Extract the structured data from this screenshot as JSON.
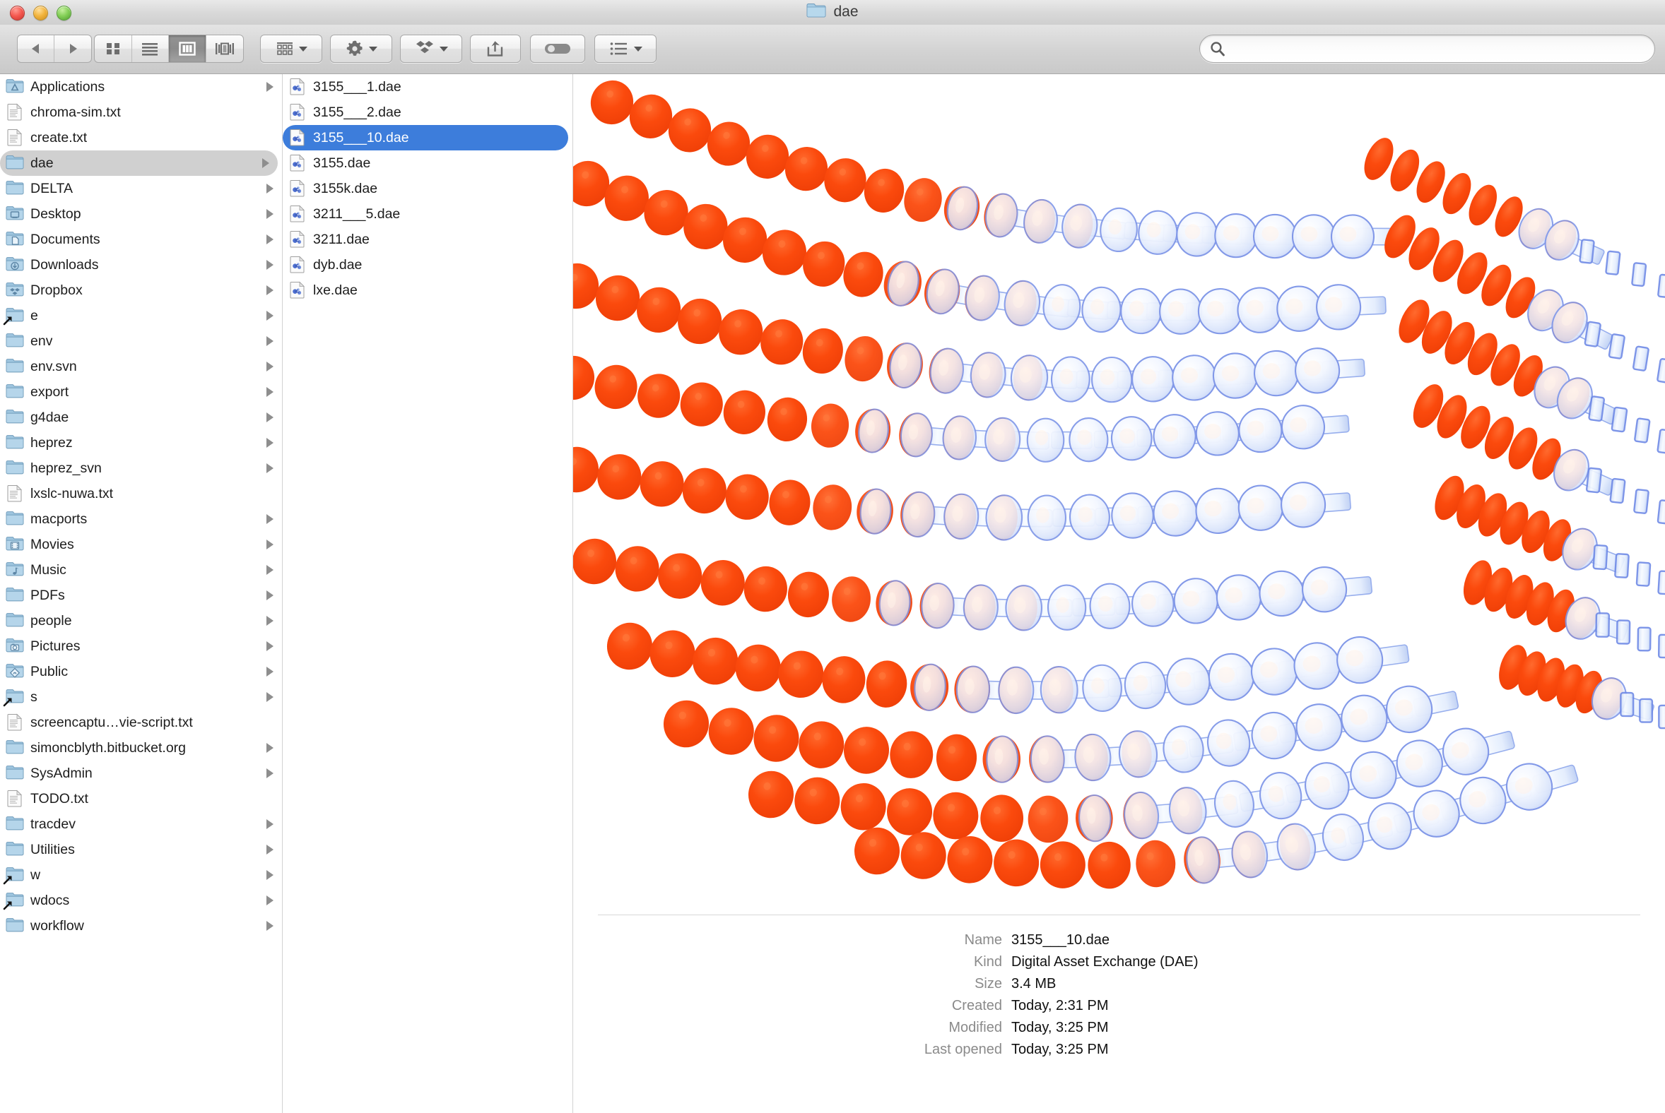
{
  "window": {
    "title": "dae",
    "title_icon": "folder-icon",
    "traffic_lights": [
      "close-button",
      "minimize-button",
      "zoom-button"
    ]
  },
  "toolbar": {
    "back_label": "Back",
    "forward_label": "Forward",
    "view_modes": [
      {
        "name": "icon-view",
        "label": "Icon View",
        "active": false
      },
      {
        "name": "list-view",
        "label": "List View",
        "active": false
      },
      {
        "name": "column-view",
        "label": "Column View",
        "active": true
      },
      {
        "name": "coverflow-view",
        "label": "Cover Flow View",
        "active": false
      }
    ],
    "buttons": [
      {
        "name": "arrange-button",
        "label": "Arrange",
        "icon": "grid-arrange-icon",
        "has_caret": true
      },
      {
        "name": "action-button",
        "label": "Action",
        "icon": "gear-icon",
        "has_caret": true
      },
      {
        "name": "dropbox-button",
        "label": "Dropbox",
        "icon": "dropbox-icon",
        "has_caret": true
      },
      {
        "name": "share-button",
        "label": "Share",
        "icon": "share-arrow-icon",
        "has_caret": false
      },
      {
        "name": "tags-button",
        "label": "Tags",
        "icon": "tag-icon",
        "has_caret": false
      },
      {
        "name": "list-options-button",
        "label": "List Options",
        "icon": "bulleted-list-icon",
        "has_caret": true
      }
    ],
    "search": {
      "placeholder": "",
      "value": "",
      "icon": "search-icon"
    }
  },
  "columns": {
    "column1": {
      "name": "sidebar-column",
      "items": [
        {
          "label": "Applications",
          "icon": "applications-folder-icon",
          "kind": "folder",
          "disclosure": true,
          "selected": false,
          "alias": false
        },
        {
          "label": "chroma-sim.txt",
          "icon": "text-document-icon",
          "kind": "file",
          "disclosure": false,
          "selected": false,
          "alias": false
        },
        {
          "label": "create.txt",
          "icon": "text-document-icon",
          "kind": "file",
          "disclosure": false,
          "selected": false,
          "alias": false
        },
        {
          "label": "dae",
          "icon": "folder-icon",
          "kind": "folder",
          "disclosure": true,
          "selected": true,
          "alias": false
        },
        {
          "label": "DELTA",
          "icon": "folder-icon",
          "kind": "folder",
          "disclosure": true,
          "selected": false,
          "alias": false
        },
        {
          "label": "Desktop",
          "icon": "desktop-folder-icon",
          "kind": "folder",
          "disclosure": true,
          "selected": false,
          "alias": false
        },
        {
          "label": "Documents",
          "icon": "documents-folder-icon",
          "kind": "folder",
          "disclosure": true,
          "selected": false,
          "alias": false
        },
        {
          "label": "Downloads",
          "icon": "downloads-folder-icon",
          "kind": "folder",
          "disclosure": true,
          "selected": false,
          "alias": false
        },
        {
          "label": "Dropbox",
          "icon": "dropbox-folder-icon",
          "kind": "folder",
          "disclosure": true,
          "selected": false,
          "alias": false
        },
        {
          "label": "e",
          "icon": "folder-icon",
          "kind": "folder",
          "disclosure": true,
          "selected": false,
          "alias": true
        },
        {
          "label": "env",
          "icon": "folder-icon",
          "kind": "folder",
          "disclosure": true,
          "selected": false,
          "alias": false
        },
        {
          "label": "env.svn",
          "icon": "folder-icon",
          "kind": "folder",
          "disclosure": true,
          "selected": false,
          "alias": false
        },
        {
          "label": "export",
          "icon": "folder-icon",
          "kind": "folder",
          "disclosure": true,
          "selected": false,
          "alias": false
        },
        {
          "label": "g4dae",
          "icon": "folder-icon",
          "kind": "folder",
          "disclosure": true,
          "selected": false,
          "alias": false
        },
        {
          "label": "heprez",
          "icon": "folder-icon",
          "kind": "folder",
          "disclosure": true,
          "selected": false,
          "alias": false
        },
        {
          "label": "heprez_svn",
          "icon": "folder-icon",
          "kind": "folder",
          "disclosure": true,
          "selected": false,
          "alias": false
        },
        {
          "label": "lxslc-nuwa.txt",
          "icon": "text-document-icon",
          "kind": "file",
          "disclosure": false,
          "selected": false,
          "alias": false
        },
        {
          "label": "macports",
          "icon": "folder-icon",
          "kind": "folder",
          "disclosure": true,
          "selected": false,
          "alias": false
        },
        {
          "label": "Movies",
          "icon": "movies-folder-icon",
          "kind": "folder",
          "disclosure": true,
          "selected": false,
          "alias": false
        },
        {
          "label": "Music",
          "icon": "music-folder-icon",
          "kind": "folder",
          "disclosure": true,
          "selected": false,
          "alias": false
        },
        {
          "label": "PDFs",
          "icon": "folder-icon",
          "kind": "folder",
          "disclosure": true,
          "selected": false,
          "alias": false
        },
        {
          "label": "people",
          "icon": "folder-icon",
          "kind": "folder",
          "disclosure": true,
          "selected": false,
          "alias": false
        },
        {
          "label": "Pictures",
          "icon": "pictures-folder-icon",
          "kind": "folder",
          "disclosure": true,
          "selected": false,
          "alias": false
        },
        {
          "label": "Public",
          "icon": "public-folder-icon",
          "kind": "folder",
          "disclosure": true,
          "selected": false,
          "alias": false
        },
        {
          "label": "s",
          "icon": "folder-icon",
          "kind": "folder",
          "disclosure": true,
          "selected": false,
          "alias": true
        },
        {
          "label": "screencaptu…vie-script.txt",
          "icon": "text-document-icon",
          "kind": "file",
          "disclosure": false,
          "selected": false,
          "alias": false
        },
        {
          "label": "simoncblyth.bitbucket.org",
          "icon": "folder-icon",
          "kind": "folder",
          "disclosure": true,
          "selected": false,
          "alias": false
        },
        {
          "label": "SysAdmin",
          "icon": "folder-icon",
          "kind": "folder",
          "disclosure": true,
          "selected": false,
          "alias": false
        },
        {
          "label": "TODO.txt",
          "icon": "text-document-icon",
          "kind": "file",
          "disclosure": false,
          "selected": false,
          "alias": false
        },
        {
          "label": "tracdev",
          "icon": "folder-icon",
          "kind": "folder",
          "disclosure": true,
          "selected": false,
          "alias": false
        },
        {
          "label": "Utilities",
          "icon": "folder-icon",
          "kind": "folder",
          "disclosure": true,
          "selected": false,
          "alias": false
        },
        {
          "label": "w",
          "icon": "folder-icon",
          "kind": "folder",
          "disclosure": true,
          "selected": false,
          "alias": true
        },
        {
          "label": "wdocs",
          "icon": "folder-icon",
          "kind": "folder",
          "disclosure": true,
          "selected": false,
          "alias": true
        },
        {
          "label": "workflow",
          "icon": "folder-icon",
          "kind": "folder",
          "disclosure": true,
          "selected": false,
          "alias": false
        }
      ]
    },
    "column2": {
      "name": "dae-folder-column",
      "items": [
        {
          "label": "3155___1.dae",
          "icon": "dae-file-icon",
          "selected": false
        },
        {
          "label": "3155___2.dae",
          "icon": "dae-file-icon",
          "selected": false
        },
        {
          "label": "3155___10.dae",
          "icon": "dae-file-icon",
          "selected": true
        },
        {
          "label": "3155.dae",
          "icon": "dae-file-icon",
          "selected": false
        },
        {
          "label": "3155k.dae",
          "icon": "dae-file-icon",
          "selected": false
        },
        {
          "label": "3211___5.dae",
          "icon": "dae-file-icon",
          "selected": false
        },
        {
          "label": "3211.dae",
          "icon": "dae-file-icon",
          "selected": false
        },
        {
          "label": "dyb.dae",
          "icon": "dae-file-icon",
          "selected": false
        },
        {
          "label": "lxe.dae",
          "icon": "dae-file-icon",
          "selected": false
        }
      ]
    }
  },
  "preview": {
    "name": "dae-3d-preview",
    "description": "3D rendering of photomultiplier tube array: orange ellipsoid photocathodes and pale blue glass bulbs with cylindrical stems arranged in curved rows",
    "colors": {
      "photocathode_orange": "#FB4A0D",
      "glass_blue": "#7c96e8",
      "glass_fill": "#eef3fd",
      "background": "#FFFFFF"
    },
    "metadata": [
      {
        "key": "Name",
        "value": "3155___10.dae"
      },
      {
        "key": "Kind",
        "value": "Digital Asset Exchange (DAE)"
      },
      {
        "key": "Size",
        "value": "3.4 MB"
      },
      {
        "key": "Created",
        "value": "Today, 2:31 PM"
      },
      {
        "key": "Modified",
        "value": "Today, 3:25 PM"
      },
      {
        "key": "Last opened",
        "value": "Today, 3:25 PM"
      }
    ]
  }
}
